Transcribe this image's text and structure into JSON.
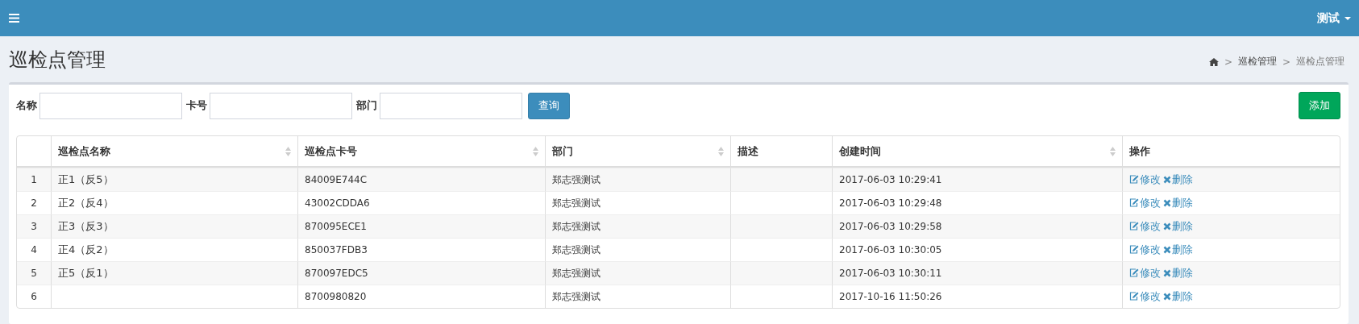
{
  "header": {
    "user": "测试"
  },
  "page": {
    "title": "巡检点管理",
    "breadcrumb": [
      {
        "separator": ">",
        "label": "巡检管理",
        "active": false
      },
      {
        "separator": ">",
        "label": "巡检点管理",
        "active": true
      }
    ]
  },
  "filters": [
    {
      "label": "名称"
    },
    {
      "label": "卡号"
    },
    {
      "label": "部门"
    }
  ],
  "search_button": "查询",
  "add_button": "添加",
  "table": {
    "columns": [
      {
        "sortable": false
      },
      {
        "label": "巡检点名称",
        "sortable": true
      },
      {
        "label": "巡检点卡号",
        "sortable": true
      },
      {
        "label": "部门",
        "sortable": true
      },
      {
        "label": "描述",
        "sortable": false
      },
      {
        "label": "创建时间",
        "sortable": true
      },
      {
        "label": "操作",
        "sortable": false
      }
    ],
    "rows": [
      {
        "index": "1",
        "name": "正1（反5）",
        "card": "84009E744C",
        "department": "郑志强测试",
        "created": "2017-06-03 10:29:41",
        "actions": [
          {
            "kind": "edit",
            "label": "修改"
          },
          {
            "kind": "delete",
            "label": "删除"
          }
        ]
      },
      {
        "index": "2",
        "name": "正2（反4）",
        "card": "43002CDDA6",
        "department": "郑志强测试",
        "created": "2017-06-03 10:29:48",
        "actions": [
          {
            "kind": "edit",
            "label": "修改"
          },
          {
            "kind": "delete",
            "label": "删除"
          }
        ]
      },
      {
        "index": "3",
        "name": "正3（反3）",
        "card": "870095ECE1",
        "department": "郑志强测试",
        "created": "2017-06-03 10:29:58",
        "actions": [
          {
            "kind": "edit",
            "label": "修改"
          },
          {
            "kind": "delete",
            "label": "删除"
          }
        ]
      },
      {
        "index": "4",
        "name": "正4（反2）",
        "card": "850037FDB3",
        "department": "郑志强测试",
        "created": "2017-06-03 10:30:05",
        "actions": [
          {
            "kind": "edit",
            "label": "修改"
          },
          {
            "kind": "delete",
            "label": "删除"
          }
        ]
      },
      {
        "index": "5",
        "name": "正5（反1）",
        "card": "870097EDC5",
        "department": "郑志强测试",
        "created": "2017-06-03 10:30:11",
        "actions": [
          {
            "kind": "edit",
            "label": "修改"
          },
          {
            "kind": "delete",
            "label": "删除"
          }
        ]
      },
      {
        "index": "6",
        "card": "8700980820",
        "department": "郑志强测试",
        "created": "2017-10-16 11:50:26",
        "actions": [
          {
            "kind": "edit",
            "label": "修改"
          },
          {
            "kind": "delete",
            "label": "删除"
          }
        ]
      }
    ]
  }
}
